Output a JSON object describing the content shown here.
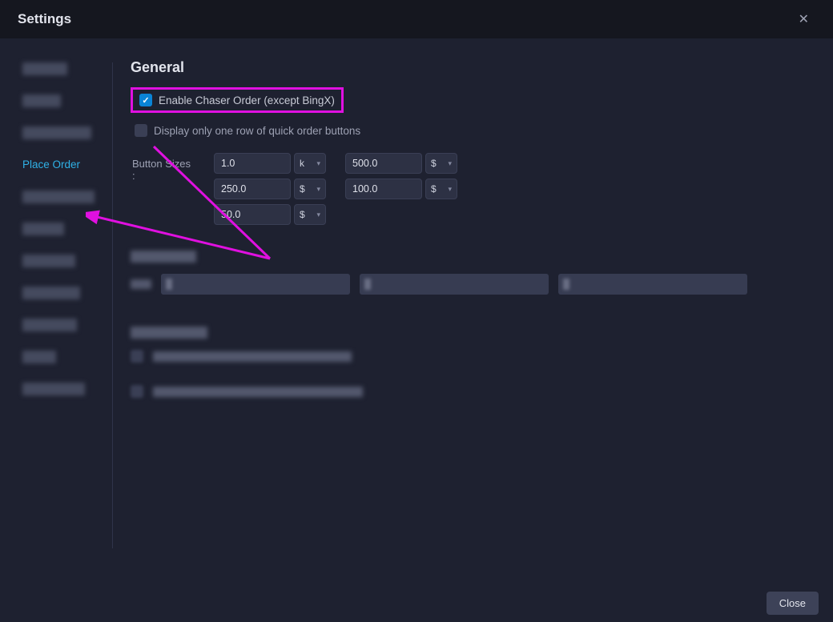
{
  "window": {
    "title": "Settings",
    "close_icon": "✕"
  },
  "sidebar": {
    "active_label": "Place Order"
  },
  "main": {
    "section_title": "General",
    "enable_chaser": {
      "label": "Enable Chaser Order (except BingX)",
      "checked": true
    },
    "display_one_row": {
      "label": "Display only one row of quick order buttons",
      "checked": false
    },
    "button_sizes_label": "Button Sizes :",
    "size_col1": [
      {
        "value": "1.0",
        "unit": "k"
      },
      {
        "value": "250.0",
        "unit": "$"
      },
      {
        "value": "50.0",
        "unit": "$"
      }
    ],
    "size_col2": [
      {
        "value": "500.0",
        "unit": "$"
      },
      {
        "value": "100.0",
        "unit": "$"
      }
    ]
  },
  "footer": {
    "close_label": "Close"
  },
  "annotation": {
    "color": "#e010e0"
  }
}
